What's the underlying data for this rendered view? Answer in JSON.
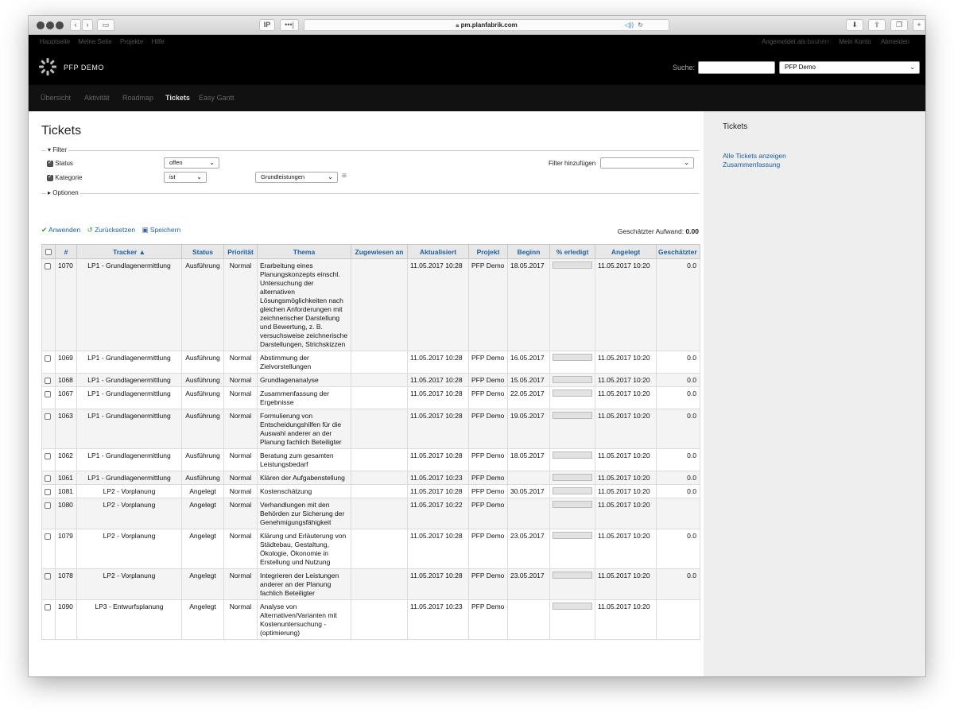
{
  "browser": {
    "url": "pm.planfabrik.com",
    "tab_label": "IP",
    "menu_dots": "•••|"
  },
  "topmenu": {
    "items": [
      "Hauptseite",
      "Meine Seite",
      "Projekte",
      "Hilfe"
    ],
    "logged_in_prefix": "Angemeldet als",
    "user": "bauherr",
    "account": "Mein Konto",
    "logout": "Abmelden"
  },
  "header": {
    "project_title": "PFP DEMO",
    "search_label": "Suche:",
    "search_value": "",
    "project_select": "PFP Demo"
  },
  "mainmenu": [
    "Übersicht",
    "Aktivität",
    "Roadmap",
    "Tickets",
    "Easy Gantt"
  ],
  "page": {
    "title": "Tickets",
    "filter_legend": "Filter",
    "status_label": "Status",
    "status_op": "offen",
    "kategorie_label": "Kategorie",
    "kategorie_op": "ist",
    "kategorie_value": "Grundleistungen",
    "add_filter_label": "Filter hinzufügen",
    "add_filter_value": "",
    "options_legend": "Optionen",
    "apply": "Anwenden",
    "reset": "Zurücksetzen",
    "save": "Speichern",
    "aufwand_label": "Geschätzter Aufwand:",
    "aufwand_value": "0.00"
  },
  "sidebar": {
    "title": "Tickets",
    "link_all": "Alle Tickets anzeigen",
    "link_summary": "Zusammenfassung"
  },
  "table": {
    "headers": [
      "#",
      "Tracker ▲",
      "Status",
      "Priorität",
      "Thema",
      "Zugewiesen an",
      "Aktualisiert",
      "Projekt",
      "Beginn",
      "% erledigt",
      "Angelegt",
      "Geschätzter"
    ],
    "rows": [
      {
        "id": "1070",
        "tracker": "LP1 - Grundlagenermittlung",
        "status": "Ausführung",
        "prio": "Normal",
        "thema": "Erarbeitung eines Planungskonzepts einschl. Untersuchung der alternativen Lösungsmöglichkeiten nach gleichen Anforderungen mit zeichnerischer Darstellung und Bewertung, z. B. versuchsweise zeichnerische Darstellungen, Strichskizzen",
        "assigned": "",
        "updated": "11.05.2017 10:28",
        "project": "PFP Demo",
        "start": "18.05.2017",
        "done": "0%",
        "created": "11.05.2017 10:20",
        "est": "0.0"
      },
      {
        "id": "1069",
        "tracker": "LP1 - Grundlagenermittlung",
        "status": "Ausführung",
        "prio": "Normal",
        "thema": "Abstimmung der Zielvorstellungen",
        "assigned": "",
        "updated": "11.05.2017 10:28",
        "project": "PFP Demo",
        "start": "16.05.2017",
        "done": "0%",
        "created": "11.05.2017 10:20",
        "est": "0.0"
      },
      {
        "id": "1068",
        "tracker": "LP1 - Grundlagenermittlung",
        "status": "Ausführung",
        "prio": "Normal",
        "thema": "Grundlagenanalyse",
        "assigned": "",
        "updated": "11.05.2017 10:28",
        "project": "PFP Demo",
        "start": "15.05.2017",
        "done": "0%",
        "created": "11.05.2017 10:20",
        "est": "0.0"
      },
      {
        "id": "1067",
        "tracker": "LP1 - Grundlagenermittlung",
        "status": "Ausführung",
        "prio": "Normal",
        "thema": "Zusammenfassung der Ergebnisse",
        "assigned": "",
        "updated": "11.05.2017 10:28",
        "project": "PFP Demo",
        "start": "22.05.2017",
        "done": "0%",
        "created": "11.05.2017 10:20",
        "est": "0.0"
      },
      {
        "id": "1063",
        "tracker": "LP1 - Grundlagenermittlung",
        "status": "Ausführung",
        "prio": "Normal",
        "thema": "Formulierung von Entscheidungshilfen für die Auswahl anderer an der Planung fachlich Beteiligter",
        "assigned": "",
        "updated": "11.05.2017 10:28",
        "project": "PFP Demo",
        "start": "19.05.2017",
        "done": "0%",
        "created": "11.05.2017 10:20",
        "est": "0.0"
      },
      {
        "id": "1062",
        "tracker": "LP1 - Grundlagenermittlung",
        "status": "Ausführung",
        "prio": "Normal",
        "thema": "Beratung zum gesamten Leistungsbedarf",
        "assigned": "",
        "updated": "11.05.2017 10:28",
        "project": "PFP Demo",
        "start": "18.05.2017",
        "done": "0%",
        "created": "11.05.2017 10:20",
        "est": "0.0"
      },
      {
        "id": "1061",
        "tracker": "LP1 - Grundlagenermittlung",
        "status": "Ausführung",
        "prio": "Normal",
        "thema": "Klären der Aufgabenstellung",
        "assigned": "",
        "updated": "11.05.2017 10:23",
        "project": "PFP Demo",
        "start": "",
        "done": "0%",
        "created": "11.05.2017 10:20",
        "est": "0.0"
      },
      {
        "id": "1081",
        "tracker": "LP2 - Vorplanung",
        "status": "Angelegt",
        "prio": "Normal",
        "thema": "Kostenschätzung",
        "assigned": "",
        "updated": "11.05.2017 10:28",
        "project": "PFP Demo",
        "start": "30.05.2017",
        "done": "0%",
        "created": "11.05.2017 10:20",
        "est": "0.0"
      },
      {
        "id": "1080",
        "tracker": "LP2 - Vorplanung",
        "status": "Angelegt",
        "prio": "Normal",
        "thema": "Verhandlungen mit den Behörden zur Sicherung der Genehmigungsfähigkeit",
        "assigned": "",
        "updated": "11.05.2017 10:22",
        "project": "PFP Demo",
        "start": "",
        "done": "0%",
        "created": "11.05.2017 10:20",
        "est": ""
      },
      {
        "id": "1079",
        "tracker": "LP2 - Vorplanung",
        "status": "Angelegt",
        "prio": "Normal",
        "thema": "Klärung und Erläuterung von Städtebau, Gestaltung, Ökologie, Ökonomie in Erstellung und Nutzung",
        "assigned": "",
        "updated": "11.05.2017 10:28",
        "project": "PFP Demo",
        "start": "23.05.2017",
        "done": "0%",
        "created": "11.05.2017 10:20",
        "est": "0.0"
      },
      {
        "id": "1078",
        "tracker": "LP2 - Vorplanung",
        "status": "Angelegt",
        "prio": "Normal",
        "thema": "Integrieren der Leistungen anderer an der Planung fachlich Beteiligter",
        "assigned": "",
        "updated": "11.05.2017 10:28",
        "project": "PFP Demo",
        "start": "23.05.2017",
        "done": "0%",
        "created": "11.05.2017 10:20",
        "est": "0.0"
      },
      {
        "id": "1090",
        "tracker": "LP3 - Entwurfsplanung",
        "status": "Angelegt",
        "prio": "Normal",
        "thema": "Analyse von Alternativen/Varianten mit Kostenuntersuchung - (optimierung)",
        "assigned": "",
        "updated": "11.05.2017 10:23",
        "project": "PFP Demo",
        "start": "",
        "done": "0%",
        "created": "11.05.2017 10:20",
        "est": ""
      }
    ]
  }
}
